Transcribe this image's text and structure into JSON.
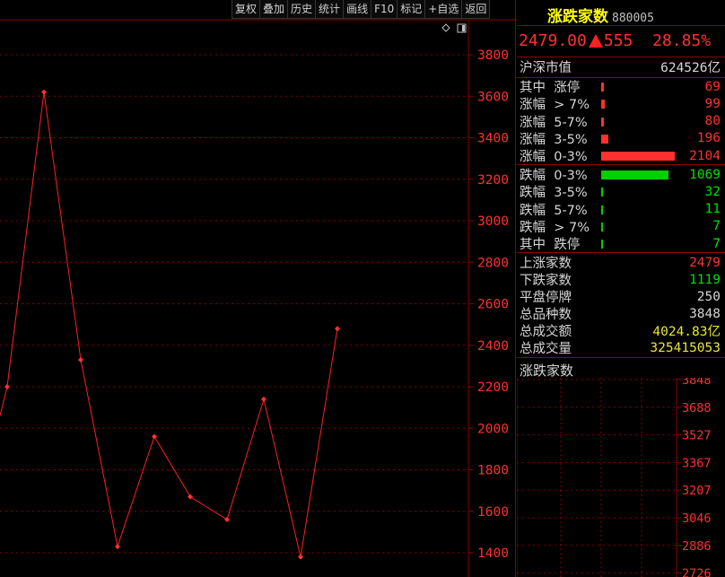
{
  "toolbar": {
    "buttons": [
      "复权",
      "叠加",
      "历史",
      "统计",
      "画线",
      "F10",
      "标记",
      "+自选",
      "返回"
    ]
  },
  "icons": {
    "diamond": "diamond-icon",
    "window": "window-toggle-icon"
  },
  "colors": {
    "up": "#ff3030",
    "down": "#00e000",
    "title": "#ffff00",
    "grid": "#8b0000",
    "line": "#ff2020"
  },
  "header": {
    "name": "涨跌家数",
    "code": "880005",
    "price": "2479.00",
    "change": "555",
    "pct": "28.85%"
  },
  "market_cap": {
    "label": "沪深市值",
    "value": "624526亿"
  },
  "up_breakdown": [
    {
      "label": "其中  涨停",
      "value": "69"
    },
    {
      "label": "涨幅  > 7%",
      "value": "99"
    },
    {
      "label": "涨幅  5-7%",
      "value": "80"
    },
    {
      "label": "涨幅  3-5%",
      "value": "196"
    },
    {
      "label": "涨幅  0-3%",
      "value": "2104"
    }
  ],
  "down_breakdown": [
    {
      "label": "跌幅  0-3%",
      "value": "1069"
    },
    {
      "label": "跌幅  3-5%",
      "value": "32"
    },
    {
      "label": "跌幅  5-7%",
      "value": "11"
    },
    {
      "label": "跌幅  > 7%",
      "value": "7"
    },
    {
      "label": "其中  跌停",
      "value": "7"
    }
  ],
  "totals": [
    {
      "label": "上涨家数",
      "value": "2479",
      "color": "red"
    },
    {
      "label": "下跌家数",
      "value": "1119",
      "color": "green"
    },
    {
      "label": "平盘停牌",
      "value": "250",
      "color": "white"
    },
    {
      "label": "总品种数",
      "value": "3848",
      "color": "white"
    },
    {
      "label": "总成交额",
      "value": "4024.83亿",
      "color": "yellow"
    },
    {
      "label": "总成交量",
      "value": "325415053",
      "color": "yellow"
    }
  ],
  "mini_chart": {
    "title": "涨跌家数",
    "ticks": [
      "3848",
      "3688",
      "3527",
      "3367",
      "3207",
      "3046",
      "2886",
      "2726"
    ]
  },
  "chart_data": {
    "type": "line",
    "x": [
      0,
      1,
      2,
      3,
      4,
      5,
      6,
      7,
      8,
      9,
      10
    ],
    "values": [
      2200,
      3620,
      2330,
      1430,
      1960,
      1670,
      1560,
      2140,
      1380,
      2480
    ],
    "leading_value": 2060,
    "ylim": [
      1300,
      3900
    ],
    "yticks": [
      1400,
      1600,
      1800,
      2000,
      2200,
      2400,
      2600,
      2800,
      3000,
      3200,
      3400,
      3600,
      3800
    ],
    "grid": true
  }
}
